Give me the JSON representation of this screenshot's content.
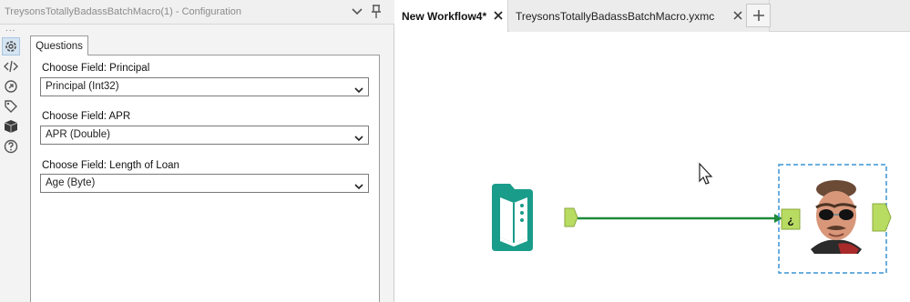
{
  "config": {
    "title": "TreysonsTotallyBadassBatchMacro(1) - Configuration",
    "dots": "...",
    "tab_questions": "Questions",
    "fields": [
      {
        "label": "Choose Field: Principal",
        "value": "Principal (Int32)"
      },
      {
        "label": "Choose Field: APR",
        "value": "APR (Double)"
      },
      {
        "label": "Choose Field: Length of Loan",
        "value": "Age (Byte)"
      }
    ],
    "side_icons": [
      "gear-icon",
      "code-icon",
      "target-icon",
      "tag-icon",
      "box-icon",
      "help-icon"
    ]
  },
  "workflow_tabs": [
    {
      "label": "New Workflow4*",
      "active": true
    },
    {
      "label": "TreysonsTotallyBadassBatchMacro.yxmc",
      "active": false
    }
  ],
  "canvas": {
    "input_tool_icon": "book-input-icon",
    "macro_input_anchor_label": "¿",
    "colors": {
      "tool_teal": "#1a9c8a",
      "connector_green": "#1e8a3a",
      "anchor_fill": "#b8db62",
      "selection": "#3a94d6"
    }
  }
}
